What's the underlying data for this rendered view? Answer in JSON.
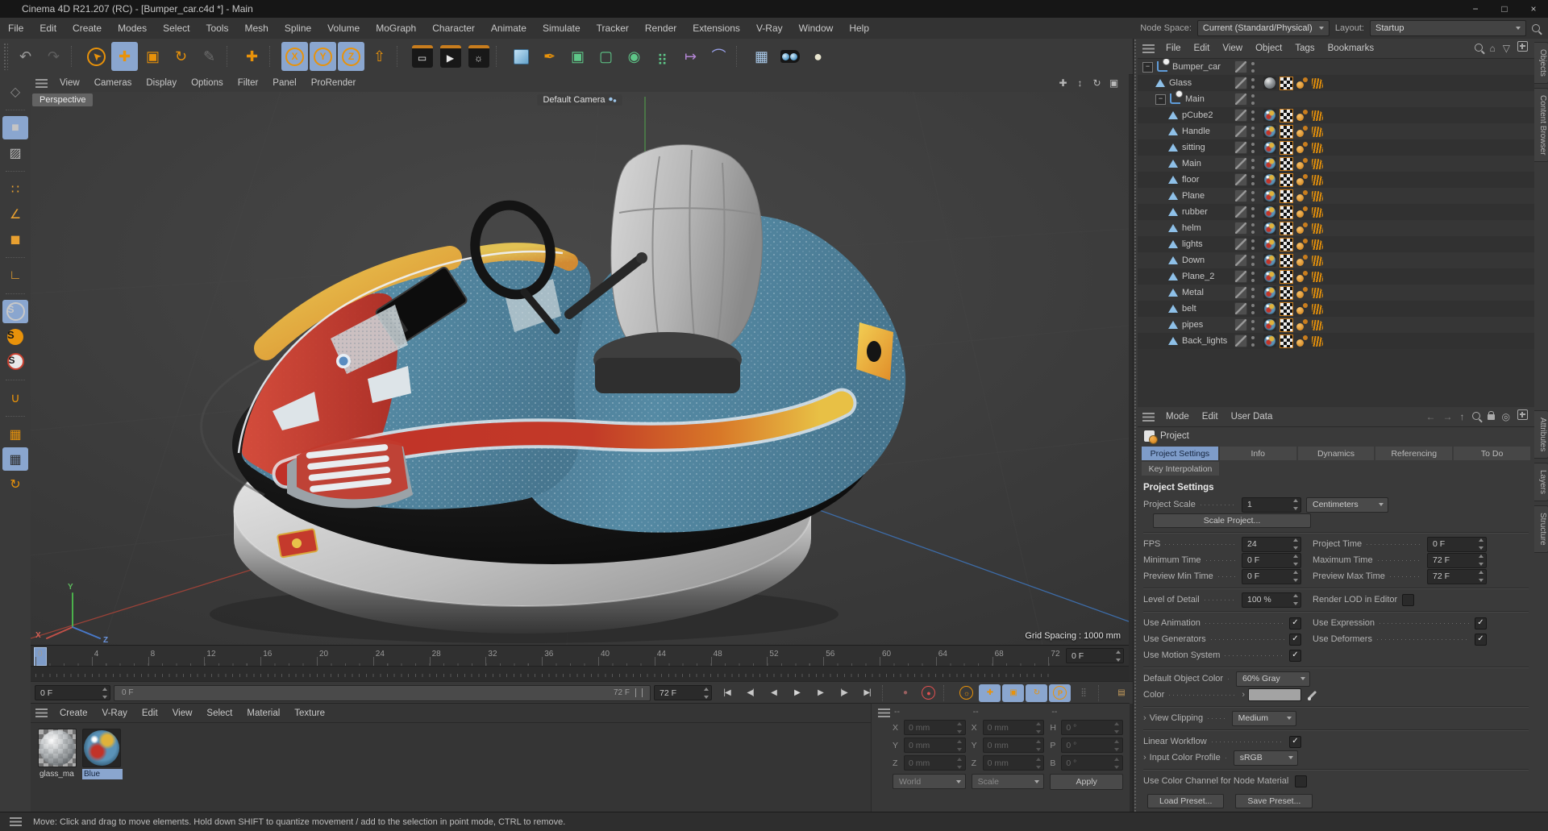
{
  "window": {
    "title": "Cinema 4D R21.207 (RC) - [Bumper_car.c4d *] - Main",
    "minimize": "−",
    "maximize": "□",
    "close": "×"
  },
  "menubar": {
    "items": [
      "File",
      "Edit",
      "Create",
      "Modes",
      "Select",
      "Tools",
      "Mesh",
      "Spline",
      "Volume",
      "MoGraph",
      "Character",
      "Animate",
      "Simulate",
      "Tracker",
      "Render",
      "Extensions",
      "V-Ray",
      "Window",
      "Help"
    ],
    "node_space_label": "Node Space:",
    "node_space_value": "Current (Standard/Physical)",
    "layout_label": "Layout:",
    "layout_value": "Startup"
  },
  "toolbar": {
    "buttons": [
      {
        "name": "undo",
        "glyph": "↶",
        "color": "#9a9a9a"
      },
      {
        "name": "redo",
        "glyph": "↷",
        "color": "#5e5e5e"
      },
      {
        "sep": true
      },
      {
        "name": "live-selection",
        "glyph": "➤",
        "color": "#e8920a",
        "rot": -135,
        "ring": true
      },
      {
        "name": "move-tool",
        "glyph": "✚",
        "color": "#e8920a",
        "active": true
      },
      {
        "name": "scale-tool",
        "glyph": "▣",
        "color": "#e8920a"
      },
      {
        "name": "rotate-tool",
        "glyph": "↻",
        "color": "#e8920a"
      },
      {
        "name": "last-used-tool",
        "glyph": "✎",
        "color": "#6e6e6e"
      },
      {
        "sep": true
      },
      {
        "name": "modeling-axis",
        "glyph": "✚",
        "color": "#e8920a"
      },
      {
        "sep": true
      },
      {
        "name": "lock-x-axis",
        "glyph": "X",
        "color": "#e8920a",
        "ring": true,
        "active": true
      },
      {
        "name": "lock-y-axis",
        "glyph": "Y",
        "color": "#e8920a",
        "ring": true,
        "active": true
      },
      {
        "name": "lock-z-axis",
        "glyph": "Z",
        "color": "#e8920a",
        "ring": true,
        "active": true
      },
      {
        "name": "coordinate-system",
        "glyph": "⇧",
        "color": "#e8920a"
      },
      {
        "sep": true
      },
      {
        "name": "render-view",
        "glyph": "▭",
        "color": "#e8e8e8",
        "tile": true
      },
      {
        "name": "render-to-picture-viewer",
        "glyph": "▶",
        "color": "#e8e8e8",
        "tile": true
      },
      {
        "name": "render-settings",
        "glyph": "☼",
        "color": "#e8e8e8",
        "tile": true
      },
      {
        "sep": true
      },
      {
        "name": "add-cube",
        "kind": "cube"
      },
      {
        "name": "add-spline",
        "glyph": "✒",
        "color": "#e8920a"
      },
      {
        "name": "add-subdivision-surface",
        "glyph": "▣",
        "color": "#5ec788"
      },
      {
        "name": "add-generator",
        "glyph": "▢",
        "color": "#5ec788"
      },
      {
        "name": "add-modeling-object",
        "glyph": "◉",
        "color": "#5ec788"
      },
      {
        "name": "add-mograph",
        "glyph": "⣶",
        "color": "#5ec788"
      },
      {
        "name": "add-xpresso",
        "glyph": "↦",
        "color": "#b486d6"
      },
      {
        "name": "add-deformer",
        "glyph": "⌒",
        "color": "#98a0e8"
      },
      {
        "sep": true
      },
      {
        "name": "add-floor",
        "glyph": "▦",
        "color": "#a8c8e8"
      },
      {
        "name": "add-camera",
        "kind": "camera"
      },
      {
        "name": "add-light",
        "glyph": "●",
        "color": "#e8e5cf"
      }
    ]
  },
  "leftstrip": {
    "buttons": [
      {
        "name": "make-editable",
        "glyph": "◇",
        "color": "#8a8a8a"
      },
      {
        "gap": true
      },
      {
        "name": "model-mode",
        "glyph": "■",
        "color": "#c4c4c4",
        "active": true
      },
      {
        "name": "texture-mode",
        "glyph": "▨",
        "color": "#b8b8b8"
      },
      {
        "gap": true
      },
      {
        "name": "points-mode",
        "glyph": "∷",
        "color": "#e8a030"
      },
      {
        "name": "edges-mode",
        "glyph": "∠",
        "color": "#e8a030"
      },
      {
        "name": "polygons-mode",
        "glyph": "◼",
        "color": "#e8a030"
      },
      {
        "gap": true
      },
      {
        "name": "axis-mode",
        "glyph": "∟",
        "color": "#e8a030"
      },
      {
        "gap": true
      },
      {
        "name": "enable-snap",
        "glyph": "S",
        "color": "#c8c8c8",
        "ring": true,
        "active": true
      },
      {
        "name": "snap-settings",
        "glyph": "S",
        "color": "#e8920a",
        "solid": true
      },
      {
        "name": "quantize-settings",
        "glyph": "S",
        "whitered": true
      },
      {
        "gap": true
      },
      {
        "name": "magnet-tool",
        "glyph": "∪",
        "color": "#e8920a"
      },
      {
        "gap": true
      },
      {
        "name": "workplane-mode",
        "glyph": "▦",
        "color": "#e8920a"
      },
      {
        "name": "lock-workplane",
        "glyph": "▦",
        "color": "#2e2e2e",
        "active": true
      },
      {
        "name": "interactive-workplane",
        "glyph": "↻",
        "color": "#e8920a"
      }
    ]
  },
  "vpmenu": {
    "items": [
      "View",
      "Cameras",
      "Display",
      "Options",
      "Filter",
      "Panel",
      "ProRender"
    ],
    "nav": [
      {
        "name": "pan-view",
        "glyph": "✚"
      },
      {
        "name": "dolly-view",
        "glyph": "↕"
      },
      {
        "name": "rotate-view",
        "glyph": "↻"
      },
      {
        "name": "toggle-view",
        "glyph": "▣"
      }
    ]
  },
  "viewport": {
    "view_label": "Perspective",
    "camera_label": "Default Camera",
    "grid_spacing": "Grid Spacing : 1000 mm",
    "axis_x": "X",
    "axis_y": "Y",
    "axis_z": "Z"
  },
  "object_manager": {
    "menu": [
      "File",
      "Edit",
      "View",
      "Object",
      "Tags",
      "Bookmarks"
    ],
    "icons": [
      {
        "name": "search",
        "kind": "search"
      },
      {
        "name": "home",
        "glyph": "⌂"
      },
      {
        "name": "filter",
        "glyph": "▽"
      },
      {
        "name": "new-panel",
        "kind": "plusbox"
      }
    ],
    "vertical_tabs": [
      "Objects",
      "Content Browser"
    ],
    "tree": [
      {
        "name": "Bumper_car",
        "icon": "null",
        "depth": 0,
        "expanded": true,
        "has_material": false
      },
      {
        "name": "Glass",
        "icon": "mesh",
        "depth": 1,
        "has_material": true,
        "material": "glass"
      },
      {
        "name": "Main",
        "icon": "null",
        "depth": 1,
        "expanded": true,
        "has_material": false
      },
      {
        "name": "pCube2",
        "icon": "mesh",
        "depth": 2,
        "has_material": true,
        "material": "color"
      },
      {
        "name": "Handle",
        "icon": "mesh",
        "depth": 2,
        "has_material": true,
        "material": "color"
      },
      {
        "name": "sitting",
        "icon": "mesh",
        "depth": 2,
        "has_material": true,
        "material": "color"
      },
      {
        "name": "Main",
        "icon": "mesh",
        "depth": 2,
        "has_material": true,
        "material": "color"
      },
      {
        "name": "floor",
        "icon": "mesh",
        "depth": 2,
        "has_material": true,
        "material": "color"
      },
      {
        "name": "Plane",
        "icon": "mesh",
        "depth": 2,
        "has_material": true,
        "material": "color"
      },
      {
        "name": "rubber",
        "icon": "mesh",
        "depth": 2,
        "has_material": true,
        "material": "color"
      },
      {
        "name": "helm",
        "icon": "mesh",
        "depth": 2,
        "has_material": true,
        "material": "color"
      },
      {
        "name": "lights",
        "icon": "mesh",
        "depth": 2,
        "has_material": true,
        "material": "color"
      },
      {
        "name": "Down",
        "icon": "mesh",
        "depth": 2,
        "has_material": true,
        "material": "color"
      },
      {
        "name": "Plane_2",
        "icon": "mesh",
        "depth": 2,
        "has_material": true,
        "material": "color"
      },
      {
        "name": "Metal",
        "icon": "mesh",
        "depth": 2,
        "has_material": true,
        "material": "color"
      },
      {
        "name": "belt",
        "icon": "mesh",
        "depth": 2,
        "has_material": true,
        "material": "color"
      },
      {
        "name": "pipes",
        "icon": "mesh",
        "depth": 2,
        "has_material": true,
        "material": "color"
      },
      {
        "name": "Back_lights",
        "icon": "mesh",
        "depth": 2,
        "has_material": true,
        "material": "color"
      }
    ]
  },
  "attributes": {
    "menu": [
      "Mode",
      "Edit",
      "User Data"
    ],
    "icons": [
      {
        "name": "nav-back",
        "glyph": "←",
        "color": "#787878"
      },
      {
        "name": "nav-forward",
        "glyph": "→",
        "color": "#787878"
      },
      {
        "name": "nav-up",
        "glyph": "↑",
        "color": "#999999"
      },
      {
        "name": "search",
        "kind": "search"
      },
      {
        "name": "lock",
        "kind": "lock"
      },
      {
        "name": "track",
        "glyph": "◎"
      },
      {
        "name": "new-panel",
        "kind": "plusbox"
      }
    ],
    "vertical_tabs": [
      "Attributes",
      "Layers",
      "Structure"
    ],
    "object_label": "Project",
    "tabs": [
      {
        "label": "Project Settings",
        "active": true
      },
      {
        "label": "Info"
      },
      {
        "label": "Dynamics"
      },
      {
        "label": "Referencing"
      },
      {
        "label": "To Do"
      }
    ],
    "tabs_row2": [
      {
        "label": "Key Interpolation"
      }
    ],
    "heading": "Project Settings",
    "project_scale_label": "Project Scale",
    "project_scale_value": "1",
    "project_scale_unit": "Centimeters",
    "scale_project_button": "Scale Project...",
    "fps_label": "FPS",
    "fps_value": "24",
    "project_time_label": "Project Time",
    "project_time_value": "0 F",
    "minimum_time_label": "Minimum Time",
    "minimum_time_value": "0 F",
    "maximum_time_label": "Maximum Time",
    "maximum_time_value": "72 F",
    "preview_min_label": "Preview Min Time",
    "preview_min_value": "0 F",
    "preview_max_label": "Preview Max Time",
    "preview_max_value": "72 F",
    "lod_label": "Level of Detail",
    "lod_value": "100 %",
    "render_lod_label": "Render LOD in Editor",
    "render_lod_checked": false,
    "use_animation_label": "Use Animation",
    "use_animation_checked": true,
    "use_expression_label": "Use Expression",
    "use_expression_checked": true,
    "use_generators_label": "Use Generators",
    "use_generators_checked": true,
    "use_deformers_label": "Use Deformers",
    "use_deformers_checked": true,
    "use_motion_label": "Use Motion System",
    "use_motion_checked": true,
    "default_color_label": "Default Object Color",
    "default_color_value": "60% Gray",
    "color_label": "Color",
    "color_swatch": "#a3a3a3",
    "view_clipping_label": "View Clipping",
    "view_clipping_value": "Medium",
    "linear_workflow_label": "Linear Workflow",
    "linear_workflow_checked": true,
    "input_profile_label": "Input Color Profile",
    "input_profile_value": "sRGB",
    "node_material_label": "Use Color Channel for Node Material",
    "node_material_checked": false,
    "load_preset_button": "Load Preset...",
    "save_preset_button": "Save Preset..."
  },
  "timeline": {
    "ticks": [
      "0",
      "4",
      "8",
      "12",
      "16",
      "20",
      "24",
      "28",
      "32",
      "36",
      "40",
      "44",
      "48",
      "52",
      "56",
      "60",
      "64",
      "68",
      "72"
    ],
    "current_frame": "0 F"
  },
  "transport": {
    "range_start": "0 F",
    "range_min_label": "0 F",
    "range_max_label": "72 F",
    "range_end": "72 F",
    "buttons": [
      {
        "name": "goto-start",
        "glyph": "|◀",
        "color": "#c8c8c8"
      },
      {
        "name": "previous-key",
        "glyph": "◀|",
        "color": "#c8c8c8"
      },
      {
        "name": "previous-frame",
        "glyph": "◀",
        "color": "#c8c8c8"
      },
      {
        "name": "play",
        "glyph": "▶",
        "color": "#d8d8d8"
      },
      {
        "name": "next-frame",
        "glyph": "▶",
        "color": "#c8c8c8"
      },
      {
        "name": "next-key",
        "glyph": "|▶",
        "color": "#c8c8c8"
      },
      {
        "name": "goto-end",
        "glyph": "▶|",
        "color": "#c8c8c8"
      },
      {
        "gap": true
      },
      {
        "name": "record-objects",
        "glyph": "●",
        "color": "#9a6060"
      },
      {
        "name": "autokeying",
        "glyph": "●",
        "color": "#e05050",
        "ring": true
      },
      {
        "gap": true
      },
      {
        "name": "keyframe-selection",
        "glyph": "☼",
        "color": "#e8920a",
        "ring": true
      },
      {
        "name": "key-position",
        "glyph": "✚",
        "color": "#e8920a",
        "active": true
      },
      {
        "name": "key-scale",
        "glyph": "▣",
        "color": "#e8920a",
        "active": true
      },
      {
        "name": "key-rotation",
        "glyph": "↻",
        "color": "#e8920a",
        "active": true
      },
      {
        "name": "key-parameter",
        "glyph": "P",
        "color": "#e8920a",
        "ring": true,
        "active": true
      },
      {
        "name": "key-point-level",
        "glyph": "⣿",
        "color": "#6a6a6a"
      },
      {
        "gap": true
      },
      {
        "name": "timeline-mode",
        "glyph": "▤",
        "color": "#caa05e"
      }
    ]
  },
  "materials": {
    "menu": [
      "Create",
      "V-Ray",
      "Edit",
      "View",
      "Select",
      "Material",
      "Texture"
    ],
    "items": [
      {
        "name": "glass_ma",
        "type": "glass",
        "selected": false
      },
      {
        "name": "Blue",
        "type": "blue",
        "selected": true
      }
    ]
  },
  "coordinates": {
    "columns": [
      {
        "header": "--",
        "rows": [
          {
            "label": "X",
            "value": "0 mm"
          },
          {
            "label": "Y",
            "value": "0 mm"
          },
          {
            "label": "Z",
            "value": "0 mm"
          }
        ],
        "footer": {
          "kind": "dropdown",
          "value": "World",
          "name": "world-dropdown"
        }
      },
      {
        "header": "--",
        "rows": [
          {
            "label": "X",
            "value": "0 mm"
          },
          {
            "label": "Y",
            "value": "0 mm"
          },
          {
            "label": "Z",
            "value": "0 mm"
          }
        ],
        "footer": {
          "kind": "dropdown",
          "value": "Scale",
          "name": "scale-dropdown"
        }
      },
      {
        "header": "--",
        "rows": [
          {
            "label": "H",
            "value": "0 °"
          },
          {
            "label": "P",
            "value": "0 °"
          },
          {
            "label": "B",
            "value": "0 °"
          }
        ],
        "footer": {
          "kind": "button",
          "value": "Apply",
          "name": "apply-button"
        }
      }
    ]
  },
  "statusbar": {
    "message": "Move: Click and drag to move elements. Hold down SHIFT to quantize movement / add to the selection in point mode, CTRL to remove."
  },
  "colors": {
    "accent_blue": "#7e9cc9",
    "accent_orange": "#e8920a"
  }
}
